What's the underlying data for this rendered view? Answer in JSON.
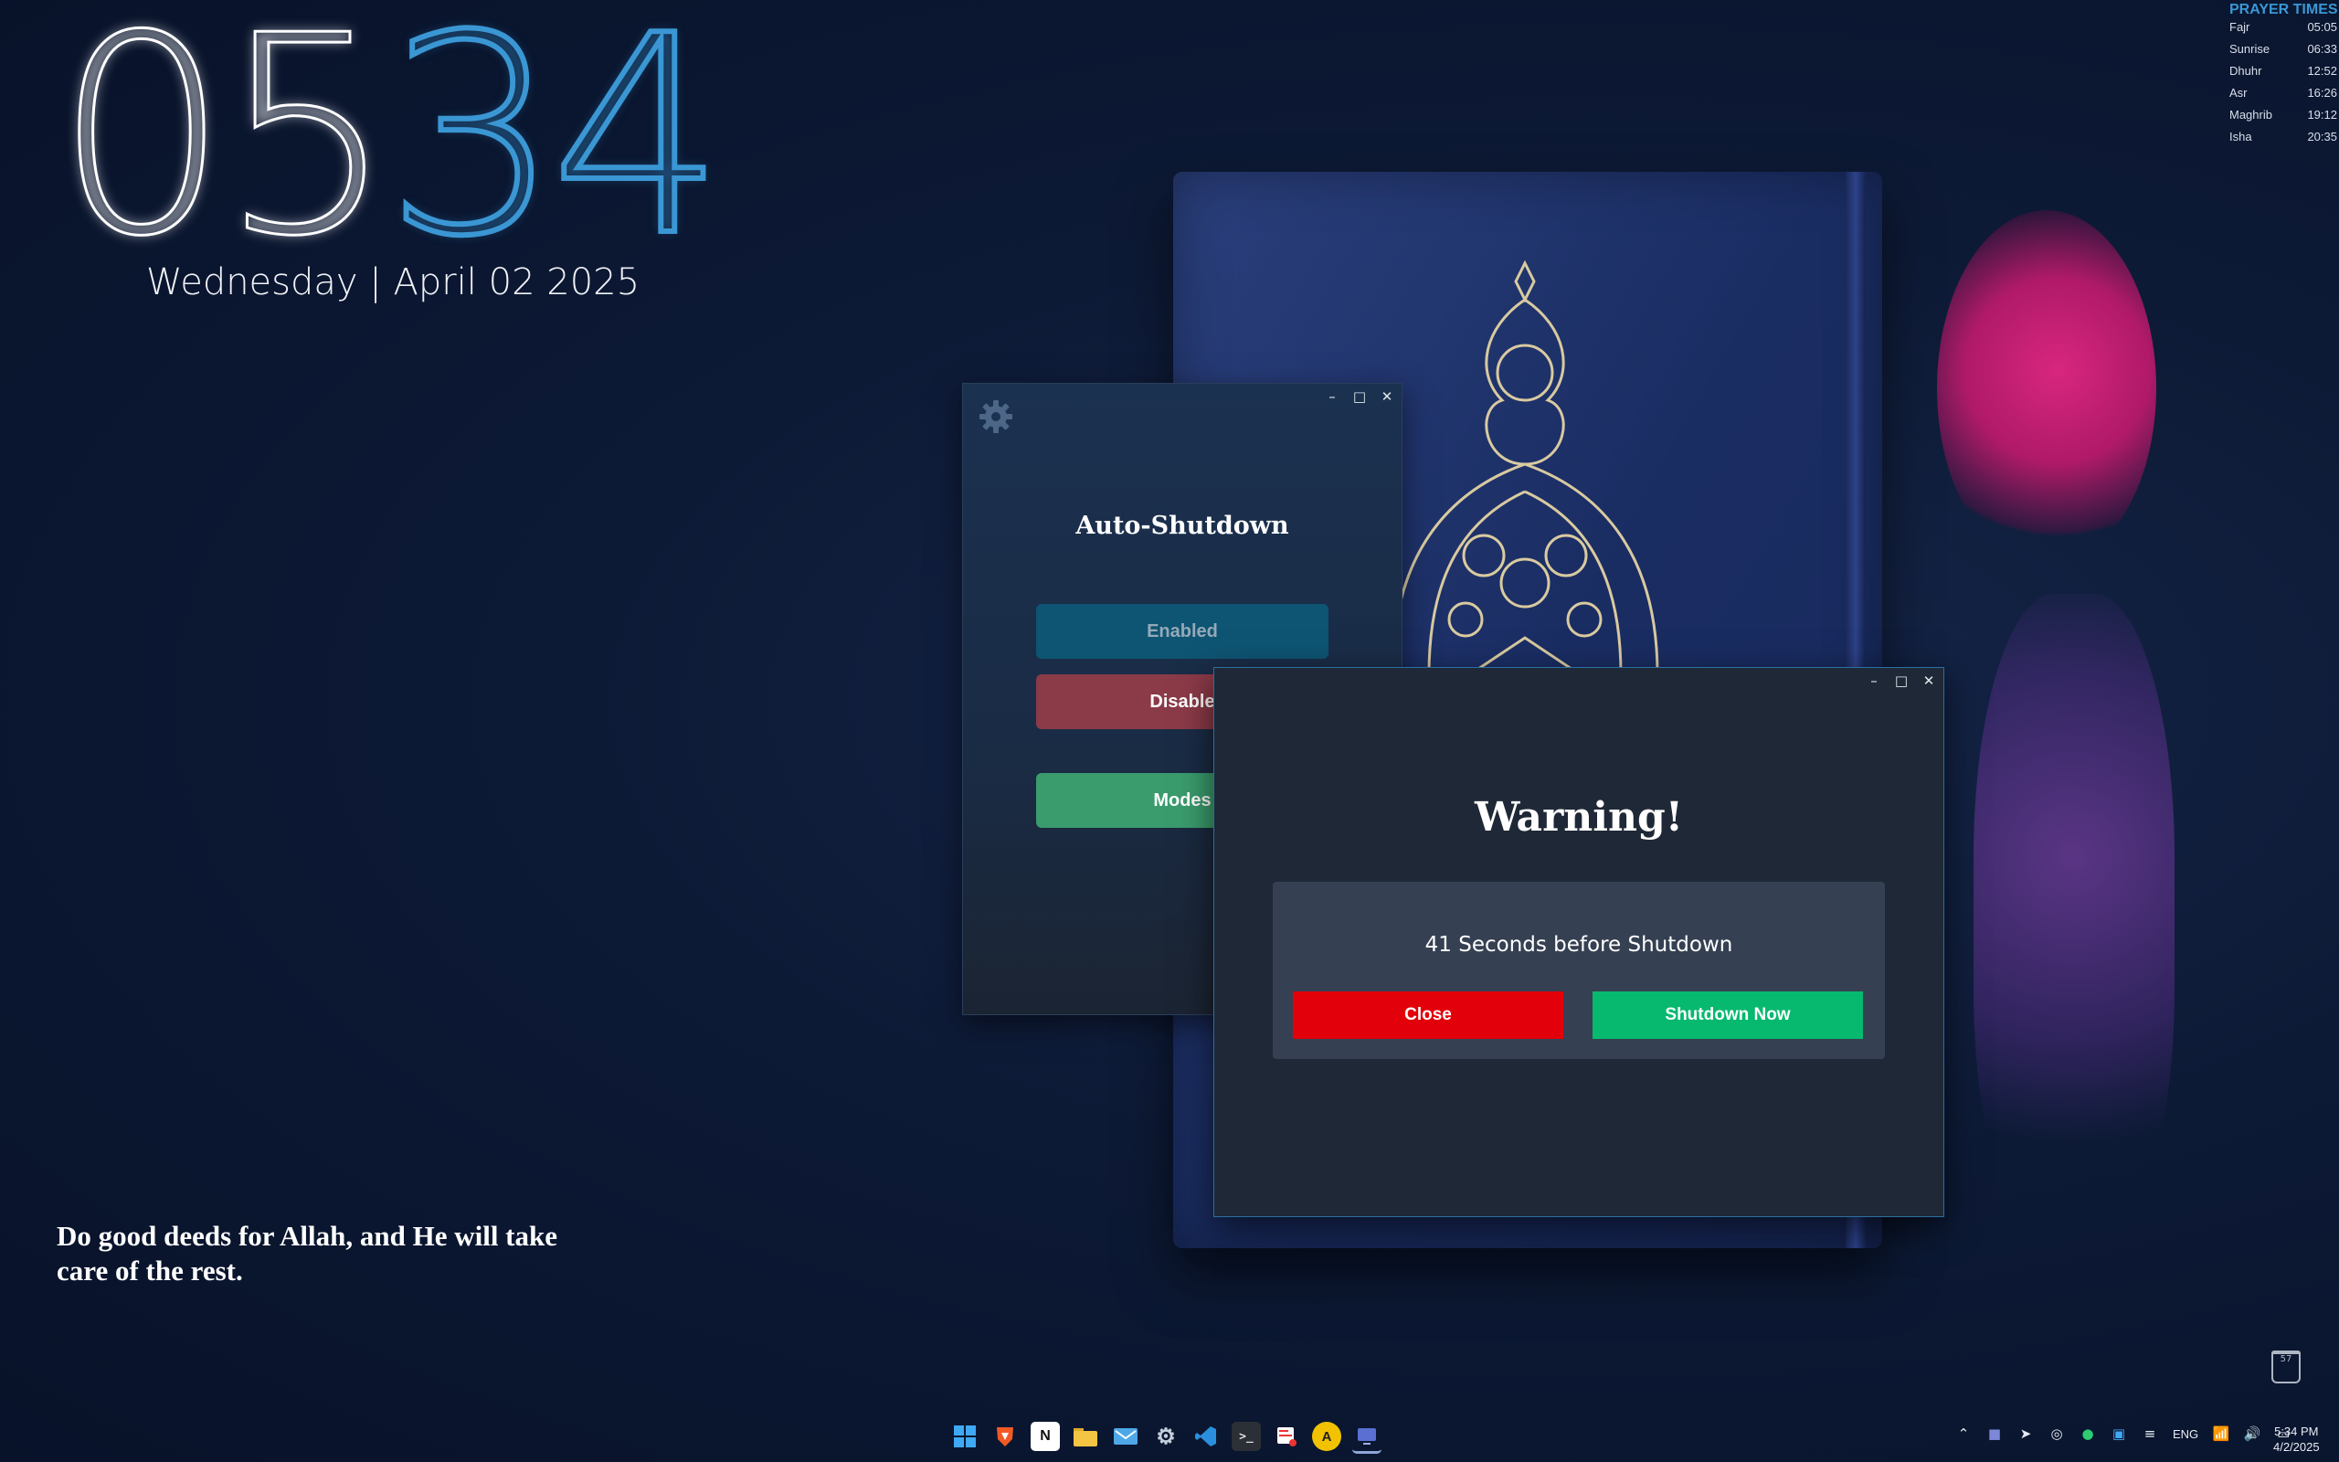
{
  "desktop": {
    "clock_hours": "05",
    "clock_minutes": "34",
    "date_line": "Wednesday | April 02 2025",
    "quote": "Do good deeds for Allah, and He will take care of the rest.",
    "recycle_bin_label": "57"
  },
  "prayer_times": {
    "title": "PRAYER TIMES",
    "items": [
      {
        "name": "Fajr",
        "time": "05:05"
      },
      {
        "name": "Sunrise",
        "time": "06:33"
      },
      {
        "name": "Dhuhr",
        "time": "12:52"
      },
      {
        "name": "Asr",
        "time": "16:26"
      },
      {
        "name": "Maghrib",
        "time": "19:12"
      },
      {
        "name": "Isha",
        "time": "20:35"
      }
    ]
  },
  "auto_shutdown": {
    "title": "Auto-Shutdown",
    "enabled_label": "Enabled",
    "disable_label": "Disable",
    "modes_label": "Modes",
    "controls": {
      "minimize": "–",
      "maximize": "□",
      "close": "✕"
    }
  },
  "warning_dialog": {
    "title": "Warning!",
    "message": "41 Seconds before Shutdown",
    "close_label": "Close",
    "shutdown_label": "Shutdown Now",
    "controls": {
      "minimize": "–",
      "maximize": "□",
      "close": "✕"
    }
  },
  "taskbar": {
    "apps": [
      "start-icon",
      "brave-icon",
      "notion-icon",
      "file-explorer-icon",
      "mail-icon",
      "settings-icon",
      "vscode-icon",
      "terminal-icon",
      "snipping-icon",
      "app-a-icon",
      "auto-shutdown-icon"
    ],
    "language": "ENG",
    "time": "5:34 PM",
    "date": "4/2/2025"
  },
  "colors": {
    "accent_blue": "#3a97d4",
    "close_red": "#e2000a",
    "shutdown_green": "#06b96f",
    "enabled_blue": "#0e5473",
    "disable_red": "#8b3a48",
    "modes_green": "#3a9c6d"
  }
}
